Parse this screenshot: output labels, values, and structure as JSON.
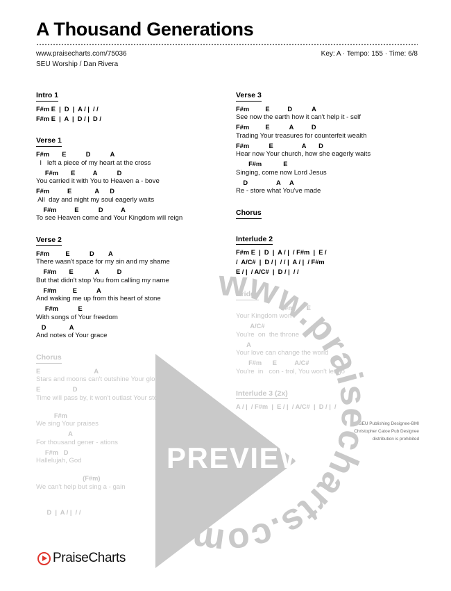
{
  "header": {
    "title": "A Thousand Generations",
    "url": "www.praisecharts.com/75036",
    "artist": "SEU Worship / Dan Rivera",
    "meta": "Key: A · Tempo: 155 · Time: 6/8"
  },
  "left_column": [
    {
      "name": "intro-1",
      "title": "Intro 1",
      "lines": [
        {
          "type": "prog",
          "text": "F#m E  |  D  |  A / |  / /"
        },
        {
          "type": "prog",
          "text": "F#m E  |  A  |  D / |  D /"
        }
      ]
    },
    {
      "name": "verse-1",
      "title": "Verse 1",
      "lines": [
        {
          "type": "chord",
          "text": "F#m       E           D           A"
        },
        {
          "type": "lyric",
          "text": "  I   left a piece of my heart at the cross"
        },
        {
          "type": "chord",
          "text": "     F#m       E          A           D"
        },
        {
          "type": "lyric",
          "text": "You carried it with You to Heaven a - bove"
        },
        {
          "type": "chord",
          "text": "F#m          E             A      D"
        },
        {
          "type": "lyric",
          "text": " All  day and night my soul eagerly waits"
        },
        {
          "type": "chord",
          "text": "    F#m          E           D          A"
        },
        {
          "type": "lyric",
          "text": "To see Heaven come and Your Kingdom will reign"
        }
      ]
    },
    {
      "name": "verse-2",
      "title": "Verse 2",
      "lines": [
        {
          "type": "chord",
          "text": "F#m         E           D        A"
        },
        {
          "type": "lyric",
          "text": "There wasn't space for my sin and my shame"
        },
        {
          "type": "chord",
          "text": "    F#m       E            A          D"
        },
        {
          "type": "lyric",
          "text": "But that didn't stop You from calling my name"
        },
        {
          "type": "chord",
          "text": "    F#m         E           A"
        },
        {
          "type": "lyric",
          "text": "And waking me up from this heart of stone"
        },
        {
          "type": "chord",
          "text": "     F#m           E"
        },
        {
          "type": "lyric",
          "text": "With songs of Your freedom"
        },
        {
          "type": "chord",
          "text": "   D             A"
        },
        {
          "type": "lyric",
          "text": "And notes of Your grace"
        }
      ]
    },
    {
      "name": "chorus-left",
      "title": "Chorus",
      "lines": [
        {
          "type": "chord",
          "text": "E                              A"
        },
        {
          "type": "lyric",
          "text": "Stars and moons can't outshine Your glory"
        },
        {
          "type": "chord",
          "text": "E                  D"
        },
        {
          "type": "lyric",
          "text": "Time will pass by, it won't outlast Your story"
        },
        {
          "type": "blank"
        },
        {
          "type": "chord",
          "text": "          F#m"
        },
        {
          "type": "lyric",
          "text": "We sing Your praises"
        },
        {
          "type": "chord",
          "text": "                  A"
        },
        {
          "type": "lyric",
          "text": "For thousand gener - ations"
        },
        {
          "type": "chord",
          "text": "     F#m   D"
        },
        {
          "type": "lyric",
          "text": "Hallelujah, God"
        },
        {
          "type": "blank"
        },
        {
          "type": "chord",
          "text": "                          (F#m)"
        },
        {
          "type": "lyric",
          "text": "We can't help but sing a - gain"
        },
        {
          "type": "blank"
        },
        {
          "type": "blank"
        },
        {
          "type": "prog",
          "text": "      D  |  A / |  / /"
        }
      ]
    }
  ],
  "right_column": [
    {
      "name": "verse-3",
      "title": "Verse 3",
      "lines": [
        {
          "type": "chord",
          "text": "F#m         E          D           A"
        },
        {
          "type": "lyric",
          "text": "See now the earth how it can't help it - self"
        },
        {
          "type": "chord",
          "text": "F#m         E           A          D"
        },
        {
          "type": "lyric",
          "text": "Trading Your treasures for counterfeit wealth"
        },
        {
          "type": "chord",
          "text": "F#m           E                A       D"
        },
        {
          "type": "lyric",
          "text": "Hear now Your church, how she eagerly waits"
        },
        {
          "type": "chord",
          "text": "       F#m            E"
        },
        {
          "type": "lyric",
          "text": "Singing, come now Lord Jesus"
        },
        {
          "type": "chord",
          "text": "    D                A     A"
        },
        {
          "type": "lyric",
          "text": "Re - store what You've made"
        }
      ]
    },
    {
      "name": "chorus-right",
      "title": "Chorus",
      "lines": []
    },
    {
      "name": "interlude-2",
      "title": "Interlude 2",
      "lines": [
        {
          "type": "prog",
          "text": "F#m E  |  D  |  A / |  / F#m  |  E /"
        },
        {
          "type": "prog",
          "text": "/  A/C#  |  D / |  / / |  A / |  / F#m"
        },
        {
          "type": "prog",
          "text": "E / |  / A/C#  |  D / |  / /"
        }
      ]
    },
    {
      "name": "bridge",
      "title": "Bridge",
      "lines": [
        {
          "type": "chord",
          "text": "                         F#m       E"
        },
        {
          "type": "lyric",
          "text": "Your Kingdom won't"
        },
        {
          "type": "chord",
          "text": "        A/C#"
        },
        {
          "type": "lyric",
          "text": "You're  on  the throne"
        },
        {
          "type": "chord",
          "text": "      A"
        },
        {
          "type": "lyric",
          "text": "Your love can change the world"
        },
        {
          "type": "chord",
          "text": "       F#m      E          A/C#"
        },
        {
          "type": "lyric",
          "text": "You're  in   con - trol, You won't let go"
        }
      ]
    },
    {
      "name": "interlude-3",
      "title": "Interlude 3 (2x)",
      "lines": [
        {
          "type": "prog",
          "text": "A / |  / F#m  |  E / |  / A/C#  |  D / |  /"
        }
      ]
    }
  ],
  "copyright": [
    "SEU Publishing Designee-BMI",
    "Christopher Catoe Pub Designee",
    "distribution is prohibited"
  ],
  "footer": {
    "logo_text": "PraiseCharts",
    "play_icon": "play-icon"
  },
  "overlay": {
    "watermark_text": "www.praisecharts.com",
    "preview_label": "PREVIEW",
    "play_icon": "play-triangle-icon",
    "watermark_color": "#c9c9c9"
  }
}
